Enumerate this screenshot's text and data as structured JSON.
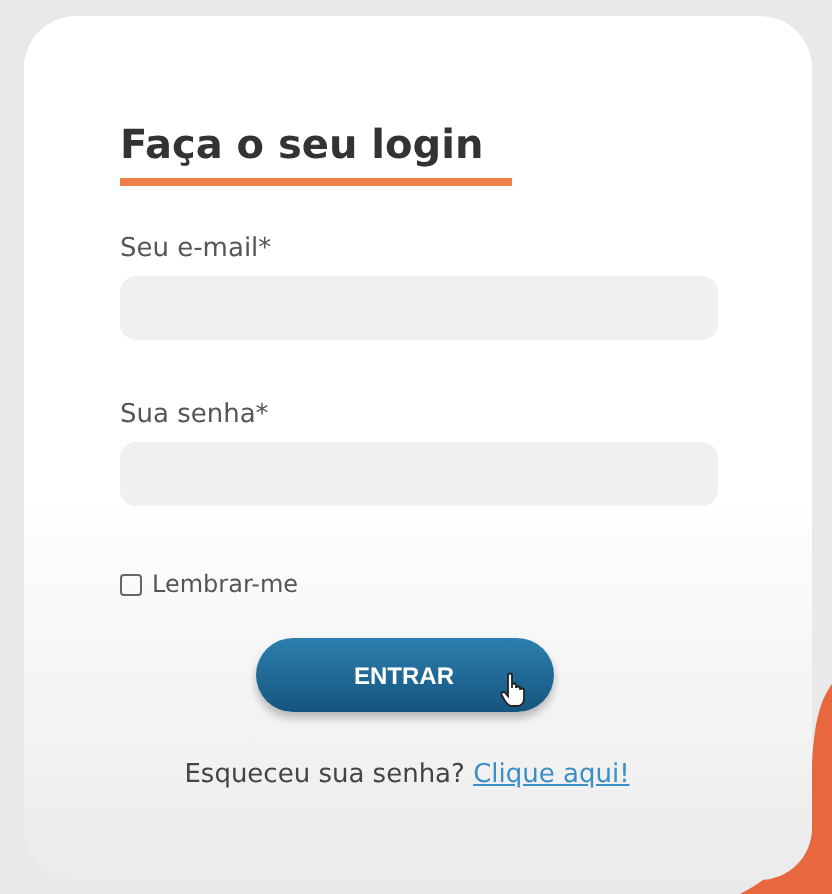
{
  "login_form": {
    "title": "Faça o seu login",
    "fields": [
      {
        "label": "Seu e-mail*"
      },
      {
        "label": "Sua senha*"
      }
    ],
    "remember": {
      "label": "Lembrar-me",
      "checked": false
    },
    "submit": "ENTRAR",
    "forgot": {
      "text": "Esqueceu sua senha?",
      "link": "Clique aqui!"
    }
  }
}
